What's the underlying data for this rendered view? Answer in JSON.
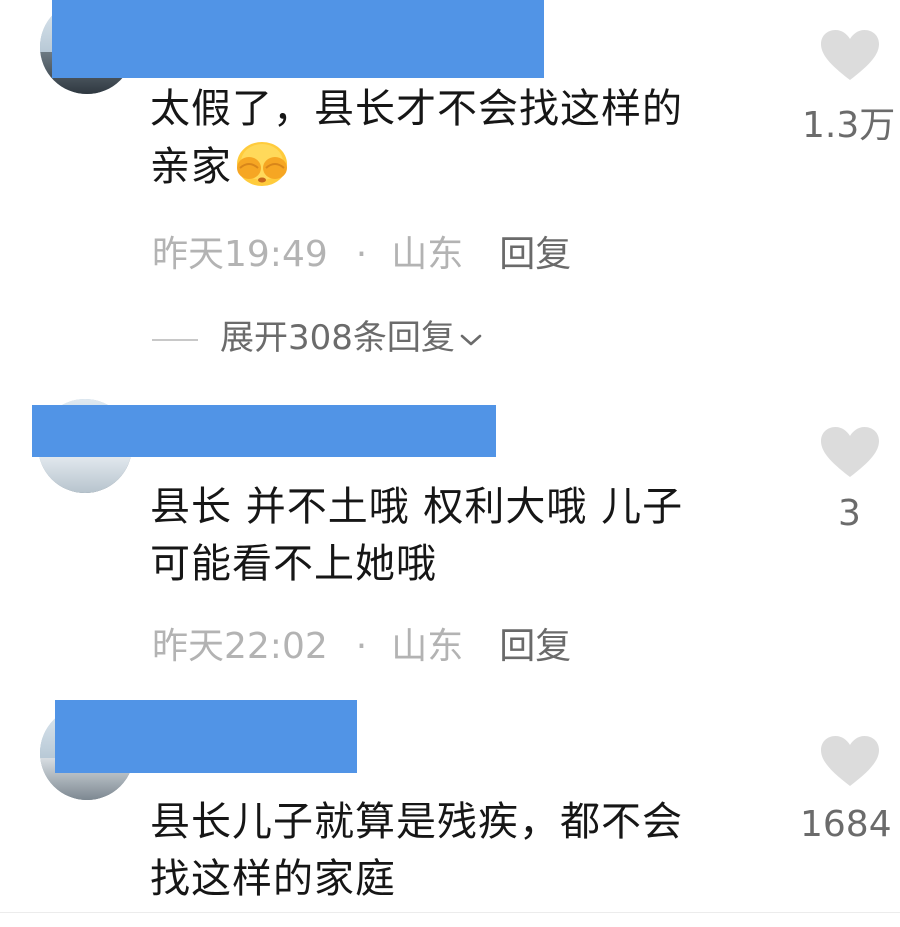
{
  "comments": [
    {
      "text_line1": "太假了，县长才不会找这样的",
      "text_line2": "亲家",
      "emoji": "face-covering-eyes-emoji",
      "time": "昨天19:49",
      "separator": "·",
      "location": "山东",
      "reply_label": "回复",
      "like_count": "1.3万",
      "expand_label": "展开308条回复"
    },
    {
      "text_line1": "县长 并不土哦 权利大哦 儿子",
      "text_line2": "可能看不上她哦",
      "time": "昨天22:02",
      "separator": "·",
      "location": "山东",
      "reply_label": "回复",
      "like_count": "3"
    },
    {
      "text_line1": "县长儿子就算是残疾，都不会",
      "text_line2": "找这样的家庭",
      "like_count": "1684"
    }
  ],
  "icons": {
    "like": "heart-icon",
    "expand": "chevron-down-icon"
  },
  "colors": {
    "redaction": "#5194e6",
    "heart": "#dcdcdc",
    "meta_text": "#b3b3b3",
    "reply_text": "#6a6a6a"
  }
}
